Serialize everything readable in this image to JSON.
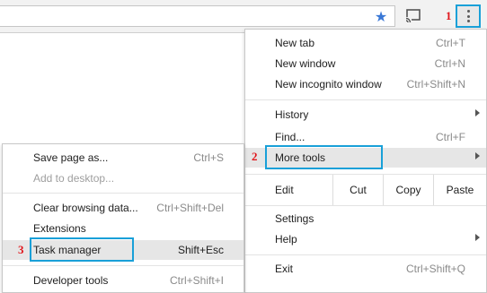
{
  "main_menu": {
    "items": [
      {
        "label": "New tab",
        "shortcut": "Ctrl+T"
      },
      {
        "label": "New window",
        "shortcut": "Ctrl+N"
      },
      {
        "label": "New incognito window",
        "shortcut": "Ctrl+Shift+N"
      },
      {
        "label": "History",
        "shortcut": ""
      },
      {
        "label": "Find...",
        "shortcut": "Ctrl+F"
      },
      {
        "label": "More tools",
        "shortcut": ""
      },
      {
        "label": "Settings",
        "shortcut": ""
      },
      {
        "label": "Help",
        "shortcut": ""
      },
      {
        "label": "Exit",
        "shortcut": "Ctrl+Shift+Q"
      }
    ],
    "edit": {
      "label": "Edit",
      "cut": "Cut",
      "copy": "Copy",
      "paste": "Paste"
    }
  },
  "more_tools_menu": {
    "items": [
      {
        "label": "Save page as...",
        "shortcut": "Ctrl+S"
      },
      {
        "label": "Add to desktop...",
        "shortcut": ""
      },
      {
        "label": "Clear browsing data...",
        "shortcut": "Ctrl+Shift+Del"
      },
      {
        "label": "Extensions",
        "shortcut": ""
      },
      {
        "label": "Task manager",
        "shortcut": "Shift+Esc"
      },
      {
        "label": "Developer tools",
        "shortcut": "Ctrl+Shift+I"
      }
    ]
  },
  "steps": {
    "one": "1",
    "two": "2",
    "three": "3"
  },
  "colors": {
    "highlight_box": "#19a0d8",
    "step_number": "#e0161c",
    "bookmark_star": "#3a78d6"
  },
  "icons": {
    "bookmark": "star-icon",
    "cast": "cast-icon",
    "menu": "kebab-menu-icon",
    "submenu": "chevron-right-icon"
  }
}
